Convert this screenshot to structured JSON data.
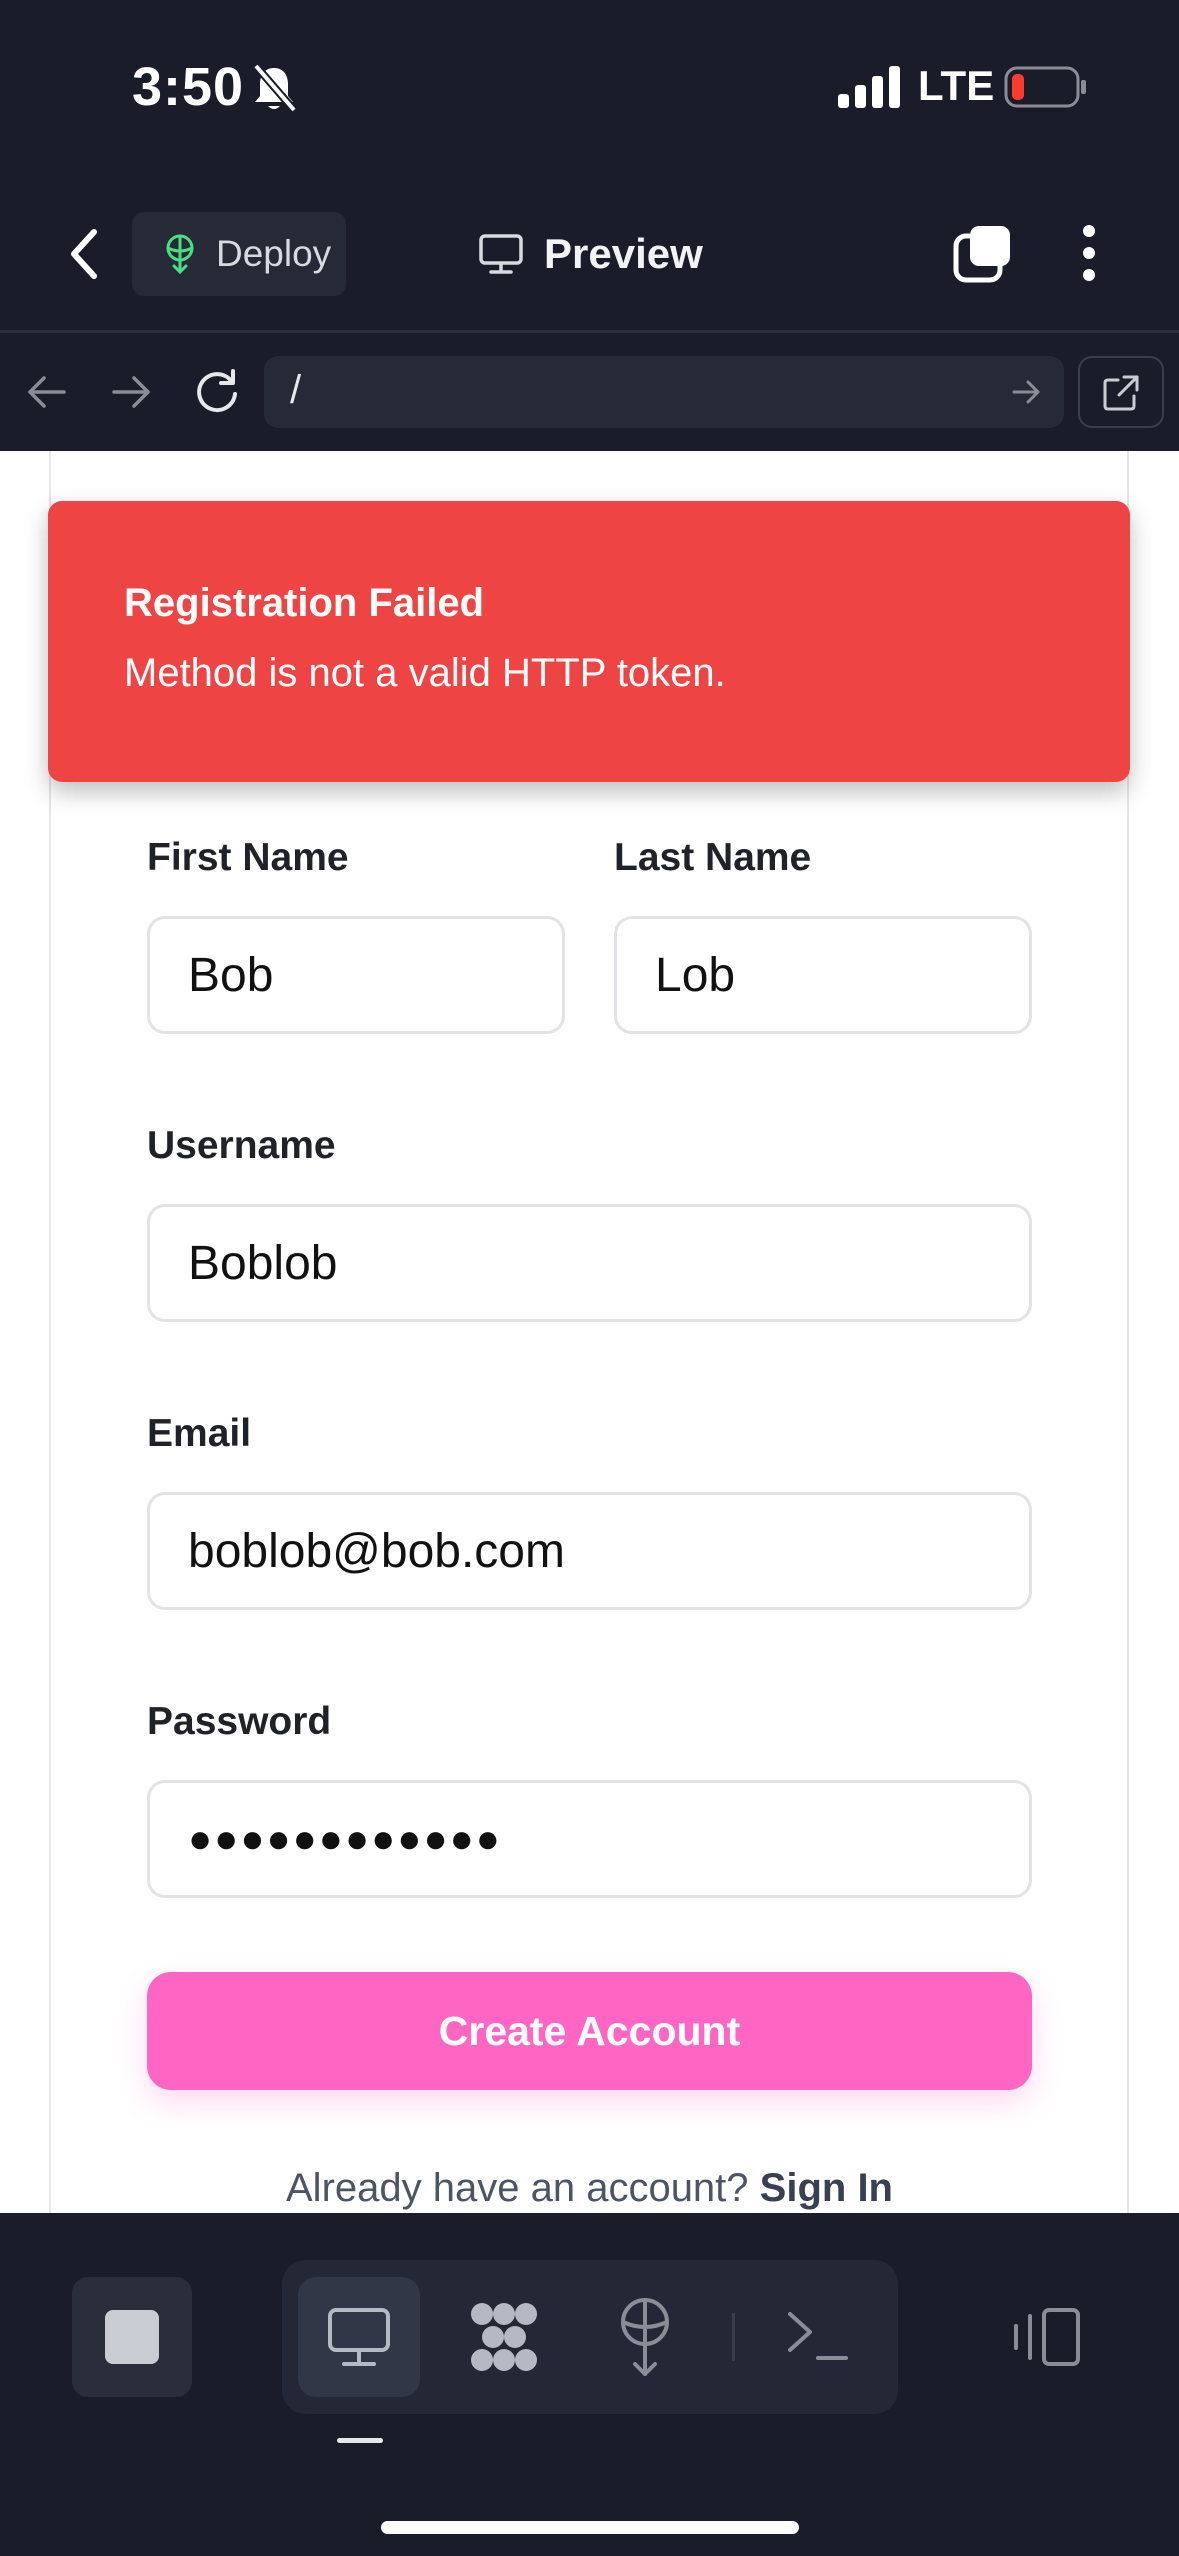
{
  "status_bar": {
    "time": "3:50",
    "network": "LTE",
    "battery_level": 0.1
  },
  "header": {
    "deploy_label": "Deploy",
    "preview_label": "Preview"
  },
  "url_bar": {
    "path": "/"
  },
  "alert": {
    "title": "Registration Failed",
    "message": "Method is not a valid HTTP token."
  },
  "form": {
    "first_name": {
      "label": "First Name",
      "value": "Bob"
    },
    "last_name": {
      "label": "Last Name",
      "value": "Lob"
    },
    "username": {
      "label": "Username",
      "value": "Boblob"
    },
    "email": {
      "label": "Email",
      "value": "boblob@bob.com"
    },
    "password": {
      "label": "Password",
      "value": "●●●●●●●●●●●●"
    },
    "submit_label": "Create Account",
    "signin_prompt": "Already have an account?",
    "signin_link": "Sign In"
  },
  "colors": {
    "alert_red": "#ef4444",
    "button_pink": "#ff66c4",
    "chrome_dark": "#1a1d29",
    "deploy_icon_green": "#4ade80"
  }
}
